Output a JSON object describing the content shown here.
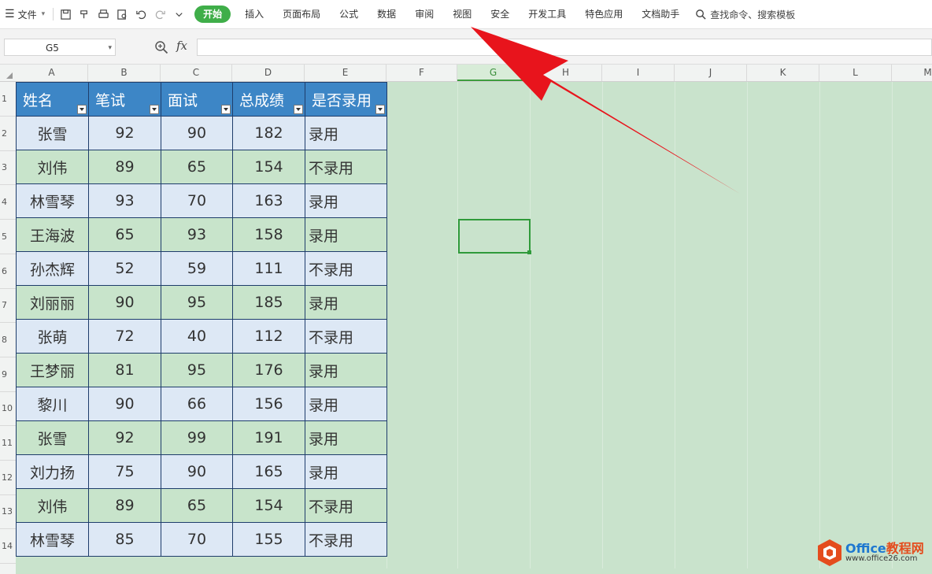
{
  "menubar": {
    "file_label": "文件",
    "tabs": [
      "开始",
      "插入",
      "页面布局",
      "公式",
      "数据",
      "审阅",
      "视图",
      "安全",
      "开发工具",
      "特色应用",
      "文档助手"
    ],
    "active_tab": "开始",
    "search_label": "查找命令、搜索模板"
  },
  "formula_bar": {
    "name_box": "G5",
    "fx_label": "fx",
    "formula": ""
  },
  "columns": [
    "A",
    "B",
    "C",
    "D",
    "E",
    "F",
    "G",
    "H",
    "I",
    "J",
    "K",
    "L",
    "M"
  ],
  "selected_column": "G",
  "rows": [
    "1",
    "2",
    "3",
    "4",
    "5",
    "6",
    "7",
    "8",
    "9",
    "10",
    "11",
    "12",
    "13",
    "14"
  ],
  "table": {
    "headers": [
      "姓名",
      "笔试",
      "面试",
      "总成绩",
      "是否录用"
    ],
    "records": [
      [
        "张雪",
        "92",
        "90",
        "182",
        "录用"
      ],
      [
        "刘伟",
        "89",
        "65",
        "154",
        "不录用"
      ],
      [
        "林雪琴",
        "93",
        "70",
        "163",
        "录用"
      ],
      [
        "王海波",
        "65",
        "93",
        "158",
        "录用"
      ],
      [
        "孙杰辉",
        "52",
        "59",
        "111",
        "不录用"
      ],
      [
        "刘丽丽",
        "90",
        "95",
        "185",
        "录用"
      ],
      [
        "张萌",
        "72",
        "40",
        "112",
        "不录用"
      ],
      [
        "王梦丽",
        "81",
        "95",
        "176",
        "录用"
      ],
      [
        "黎川",
        "90",
        "66",
        "156",
        "录用"
      ],
      [
        "张雪",
        "92",
        "99",
        "191",
        "录用"
      ],
      [
        "刘力扬",
        "75",
        "90",
        "165",
        "录用"
      ],
      [
        "刘伟",
        "89",
        "65",
        "154",
        "不录用"
      ],
      [
        "林雪琴",
        "85",
        "70",
        "155",
        "不录用"
      ]
    ]
  },
  "watermark": {
    "brand_main": "Office",
    "brand_accent": "教程网",
    "url": "www.office26.com"
  },
  "colors": {
    "accent_green": "#3fae49",
    "header_blue": "#3d86c6",
    "arrow_red": "#e8141c",
    "sheet_bg": "#c9e3cc"
  }
}
